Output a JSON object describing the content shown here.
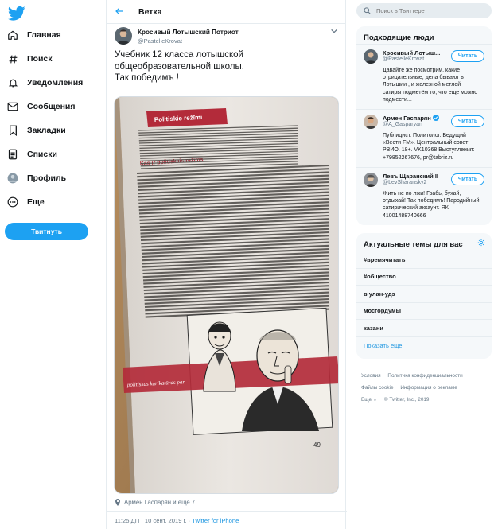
{
  "nav": {
    "items": [
      {
        "label": "Главная",
        "icon": "home-icon"
      },
      {
        "label": "Поиск",
        "icon": "hashtag-icon"
      },
      {
        "label": "Уведомления",
        "icon": "bell-icon"
      },
      {
        "label": "Сообщения",
        "icon": "envelope-icon"
      },
      {
        "label": "Закладки",
        "icon": "bookmark-icon"
      },
      {
        "label": "Списки",
        "icon": "list-icon"
      },
      {
        "label": "Профиль",
        "icon": "profile-icon"
      },
      {
        "label": "Еще",
        "icon": "more-icon"
      }
    ],
    "tweet_button": "Твитнуть"
  },
  "thread": {
    "title": "Ветка",
    "author_name": "Кросивый Лотышский Потриот",
    "author_handle": "@PastelleKrovat",
    "text_line1": "Учебник 12 класса лотышской",
    "text_line2": "общеобразовательной школы.",
    "text_line3": "Так победимъ !",
    "retweeted_by": "Армен Гаспарян и еще 7",
    "time": "11:25 ДП · 10 сент. 2019 г. · ",
    "via": "Twitter for iPhone"
  },
  "book": {
    "header": "Politiskie režīmi",
    "section": "Kas ir politiskais režīms",
    "caption": "politiskas karikatūras par",
    "page_number": "49"
  },
  "search": {
    "placeholder": "Поиск в Твиттере"
  },
  "people": {
    "title": "Подходящие люди",
    "list": [
      {
        "name": "Кросивый Лотыш...",
        "handle": "@PastelleKrovat",
        "bio": "Давайте же посмотрим, какие отрицательные, дела бывают в Лотышии , и железной метлой сатиры подметём то, что еще можно подмести...",
        "follow": "Читать"
      },
      {
        "name": "Армен Гаспарян",
        "handle": "@A_Gasparyan",
        "bio": "Публицист. Политолог. Ведущий «Вести FM». Центральный совет РВИО. 18+. VK10368 Выступления: +79852267676, pr@tabriz.ru",
        "follow": "Читать"
      },
      {
        "name": "Левъ Щаранский II",
        "handle": "@LevSharansky2",
        "bio": "Жить не по лжи! Грабь, бухай, отдыхай! Так победимъ! Пародийный сатирический аккаунт. ЯК 41001488740666",
        "follow": "Читать"
      }
    ]
  },
  "trends": {
    "title": "Актуальные темы для вас",
    "items": [
      "#времячитать",
      "#общество",
      "в улан-удэ",
      "мосгордумы",
      "казани"
    ],
    "show_more": "Показать еще"
  },
  "footer": {
    "links": [
      "Условия",
      "Политика конфиденциальности",
      "Файлы cookie",
      "Информация о рекламе",
      "Еще ⌄",
      "© Twitter, Inc., 2019."
    ]
  },
  "colors": {
    "accent": "#1da1f2",
    "text": "#14171a",
    "muted": "#657786",
    "panel": "#f5f8fa",
    "border": "#e6ecf0"
  }
}
